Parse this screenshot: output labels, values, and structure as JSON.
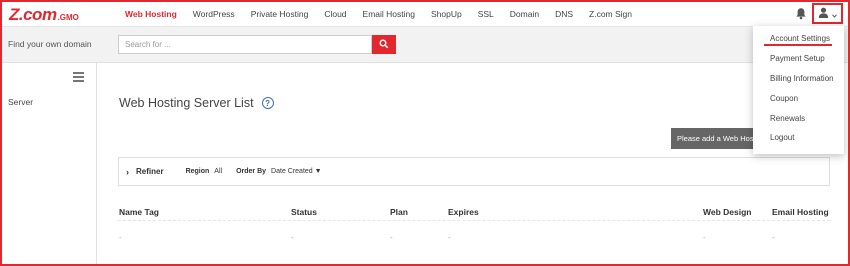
{
  "brand": {
    "logo_main": "Z.com",
    "logo_sub": ".GMO",
    "accent_color": "#e0282e"
  },
  "nav": {
    "items": [
      "Web Hosting",
      "WordPress",
      "Private Hosting",
      "Cloud",
      "Email Hosting",
      "ShopUp",
      "SSL",
      "Domain",
      "DNS",
      "Z.com Sign"
    ],
    "active": "Web Hosting",
    "bell_icon": "bell-icon",
    "user_icon": "user-icon"
  },
  "search": {
    "label": "Find your own domain",
    "placeholder": "Search for ...",
    "button_icon": "search-icon"
  },
  "sidebar": {
    "menu_icon": "hamburger-icon",
    "items": [
      "Server"
    ]
  },
  "main": {
    "title": "Web Hosting Server List",
    "help_icon_text": "?",
    "add_button": "Please add a Web Hosting",
    "refiner": {
      "toggle": "Refiner",
      "region_label": "Region",
      "region_value": "All",
      "order_label": "Order By",
      "order_value": "Date Created ▼"
    },
    "table": {
      "columns": [
        "Name Tag",
        "Status",
        "Plan",
        "Expires",
        "Web Design",
        "Email Hosting"
      ],
      "rows": [
        [
          "-",
          "-",
          "-",
          "-",
          "-",
          "-"
        ]
      ]
    }
  },
  "user_menu": {
    "items": [
      "Account Settings",
      "Payment Setup",
      "Billing Information",
      "Coupon",
      "Renewals",
      "Logout"
    ],
    "highlighted": "Account Settings"
  }
}
